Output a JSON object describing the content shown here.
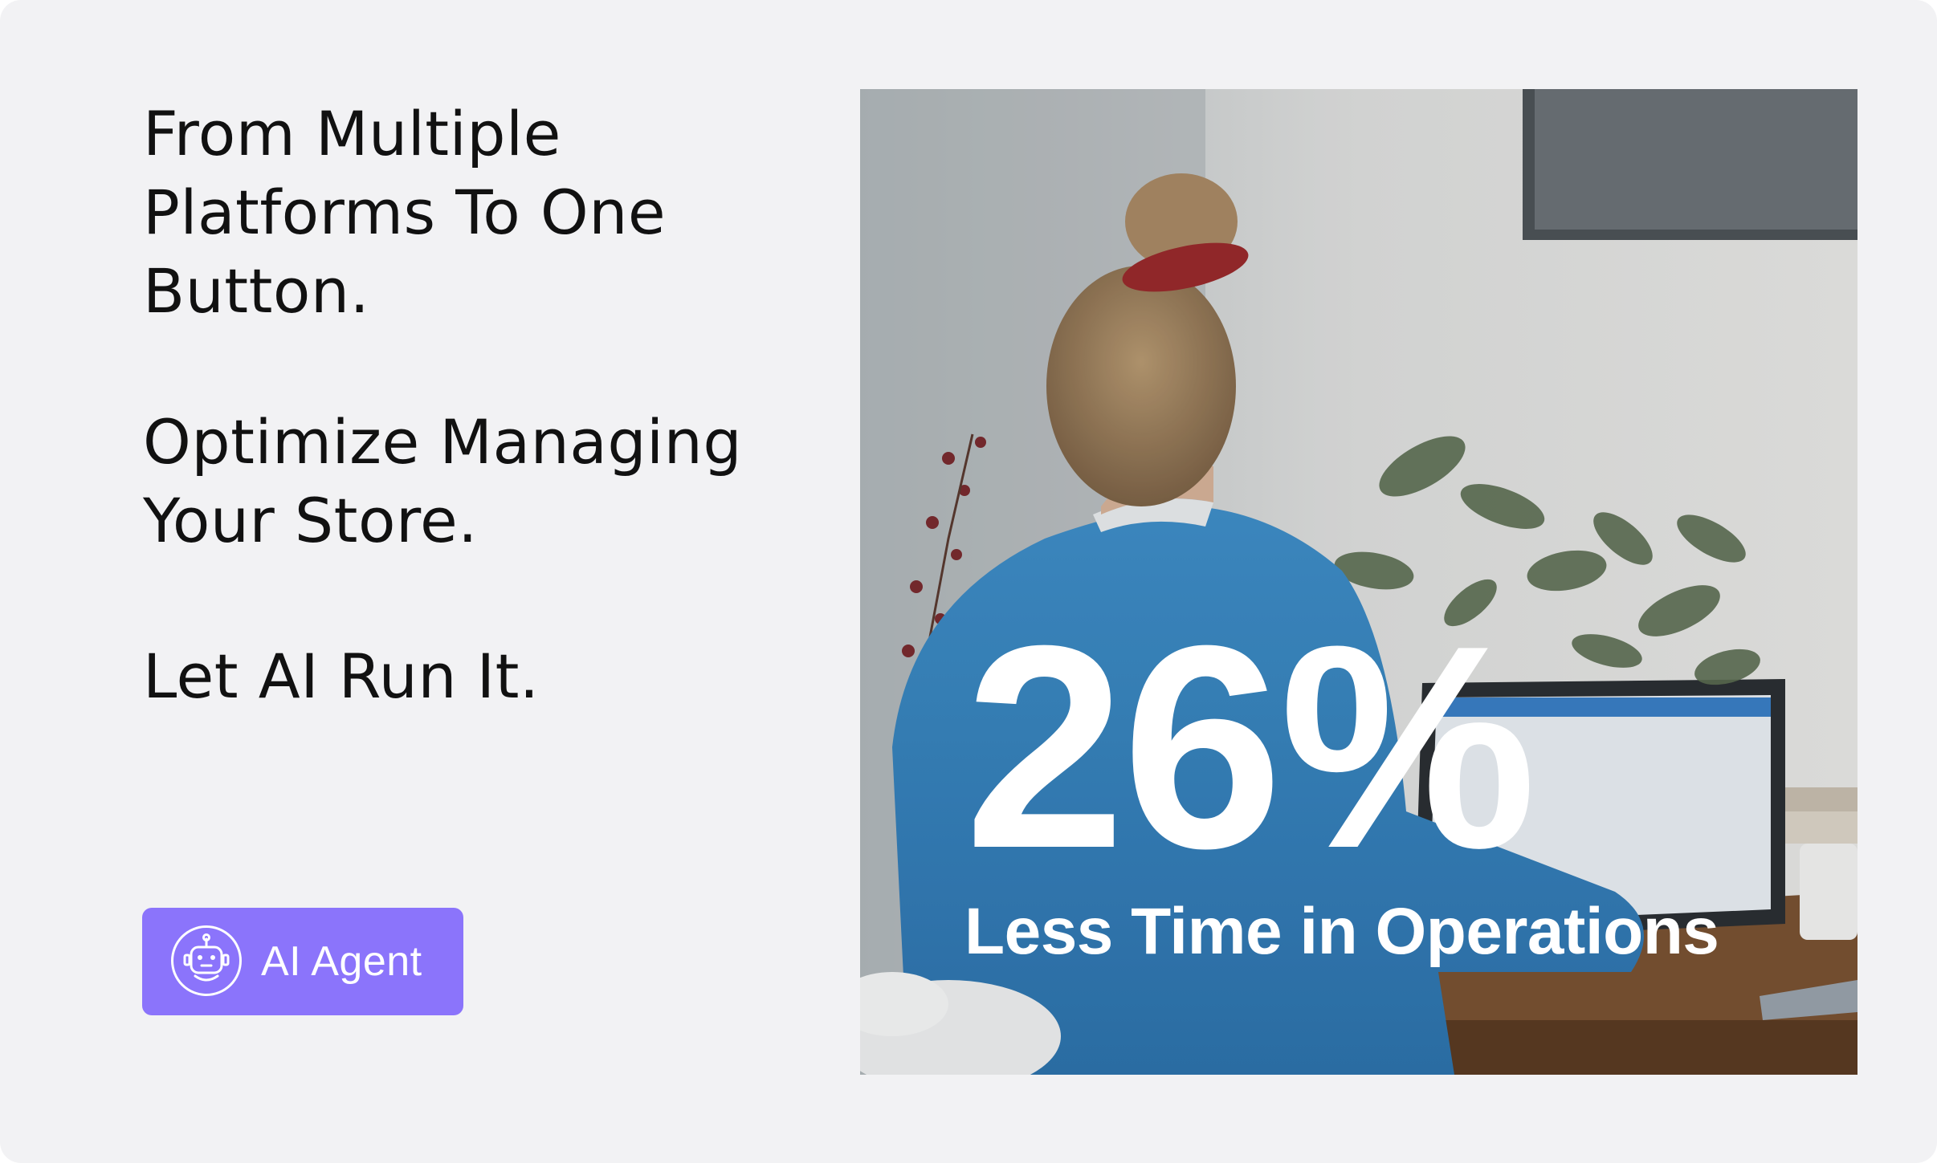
{
  "headline": {
    "line1": "From Multiple",
    "line2": "Platforms To One",
    "line3": "Button.",
    "line4": "Optimize Managing",
    "line5": "Your Store.",
    "line6": "Let AI Run It."
  },
  "cta": {
    "label": "AI Agent",
    "icon": "robot-icon",
    "color": "#8b74fb"
  },
  "stat": {
    "value": "26%",
    "caption": "Less Time in Operations"
  },
  "colors": {
    "background": "#f2f2f4",
    "text": "#111111",
    "stat_text": "#ffffff"
  }
}
